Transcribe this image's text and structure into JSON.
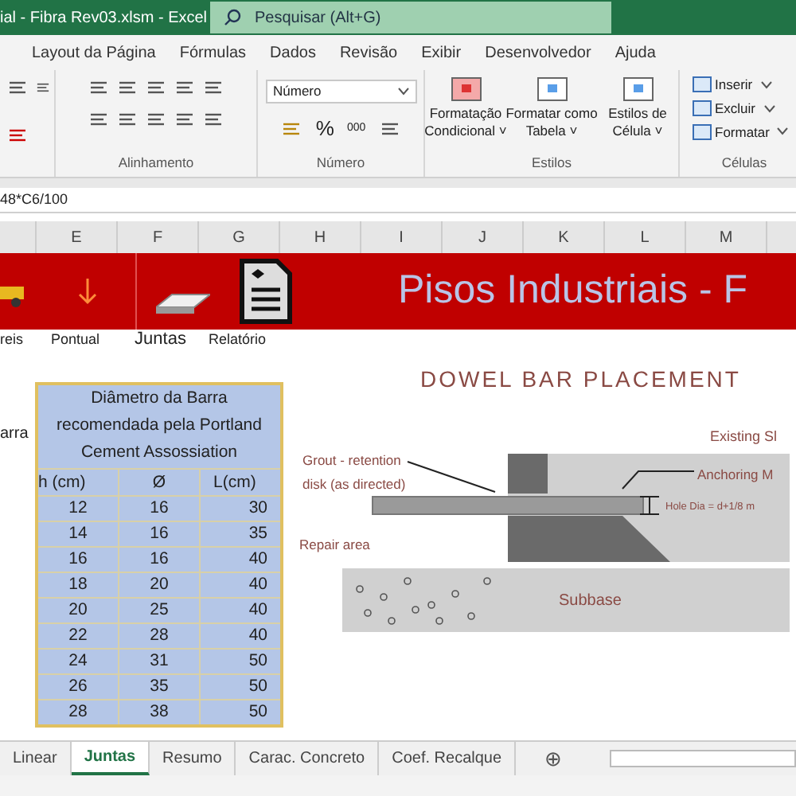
{
  "window": {
    "title": "ial - Fibra Rev03.xlsm  -  Excel",
    "search": {
      "placeholder": "Pesquisar (Alt+G)"
    }
  },
  "menu_tabs": [
    {
      "label": "Layout da Página",
      "selected": false
    },
    {
      "label": "Fórmulas",
      "selected": false
    },
    {
      "label": "Dados",
      "selected": false
    },
    {
      "label": "Revisão",
      "selected": false
    },
    {
      "label": "Exibir",
      "selected": false
    },
    {
      "label": "Desenvolvedor",
      "selected": false
    },
    {
      "label": "Ajuda",
      "selected": false
    }
  ],
  "ribbon": {
    "groups": [
      "Alinhamento",
      "Número",
      "Estilos",
      "Células"
    ],
    "number_format": "Número",
    "percent": "%",
    "thousands": "000",
    "styles": [
      [
        "Formatação",
        "Condicional ˅"
      ],
      [
        "Formatar como",
        "Tabela ˅"
      ],
      [
        "Estilos de",
        "Célula ˅"
      ]
    ],
    "cells": [
      "Inserir",
      "Excluir",
      "Formatar"
    ]
  },
  "formula": "48*C6/100",
  "columns": [
    "E",
    "F",
    "G",
    "H",
    "I",
    "J",
    "K",
    "L",
    "M"
  ],
  "banner": {
    "title": "Pisos Industriais - F",
    "buttons": [
      "reis",
      "Pontual",
      "Juntas",
      "Relatório"
    ]
  },
  "side_text": "arra",
  "table": {
    "title": "Diâmetro da Barra recomendada pela Portland Cement Assossiation",
    "columns": [
      "h (cm)",
      "Ø",
      "L(cm)"
    ],
    "rows": [
      [
        "12",
        "16",
        "30"
      ],
      [
        "14",
        "16",
        "35"
      ],
      [
        "16",
        "16",
        "40"
      ],
      [
        "18",
        "20",
        "40"
      ],
      [
        "20",
        "25",
        "40"
      ],
      [
        "22",
        "28",
        "40"
      ],
      [
        "24",
        "31",
        "50"
      ],
      [
        "26",
        "35",
        "50"
      ],
      [
        "28",
        "38",
        "50"
      ]
    ]
  },
  "diagram": {
    "title": "DOWEL BAR PLACEMENT",
    "existing": "Existing Sl",
    "grout": [
      "Grout - retention",
      "disk (as directed)"
    ],
    "anchoring": "Anchoring M",
    "hole": "Hole Dia = d+1/8 m",
    "repair": "Repair area",
    "subbase": "Subbase"
  },
  "sheet_tabs": [
    {
      "label": "Linear",
      "selected": false
    },
    {
      "label": "Juntas",
      "selected": true
    },
    {
      "label": "Resumo",
      "selected": false
    },
    {
      "label": "Carac. Concreto",
      "selected": false
    },
    {
      "label": "Coef. Recalque",
      "selected": false
    }
  ],
  "add_sheet": "⊕"
}
